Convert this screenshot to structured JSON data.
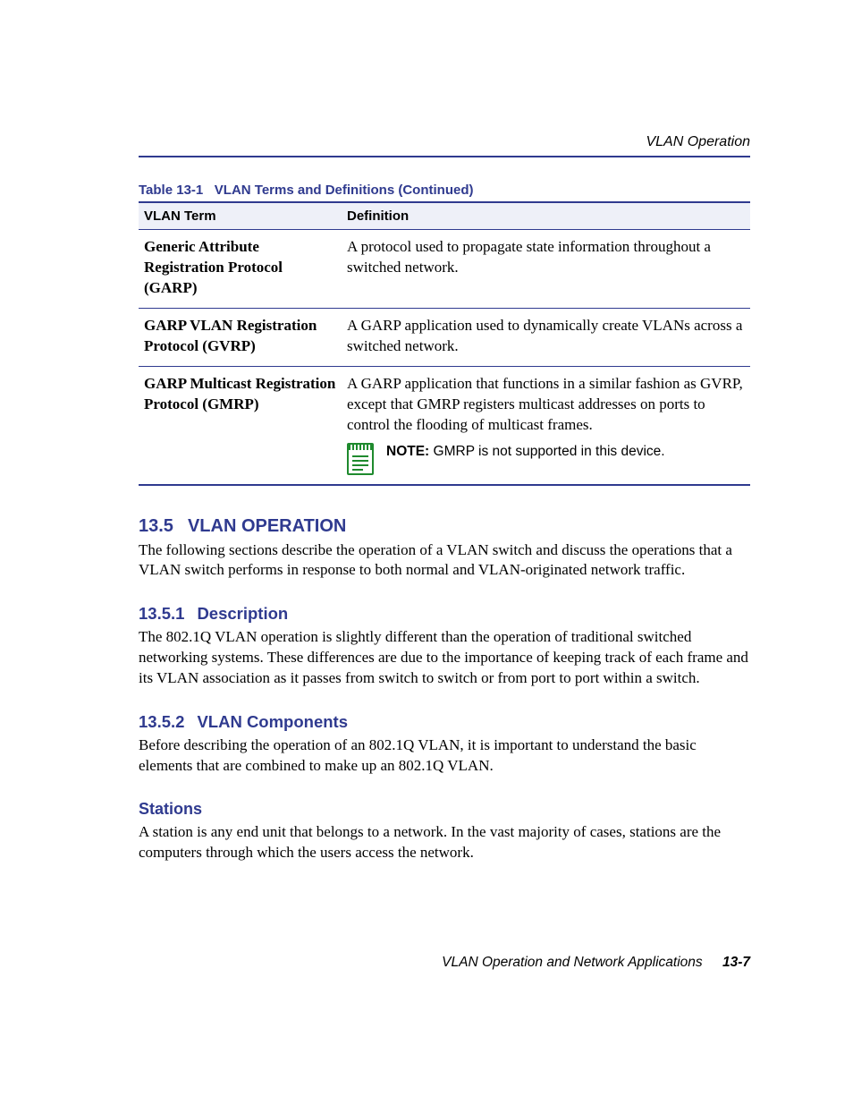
{
  "running_head": "VLAN Operation",
  "table": {
    "caption_prefix": "Table 13-1",
    "caption_title": "VLAN Terms and Definitions (Continued)",
    "headers": {
      "term": "VLAN Term",
      "definition": "Definition"
    },
    "rows": [
      {
        "term": "Generic Attribute Registration Protocol (GARP)",
        "definition": "A protocol used to propagate state information throughout a switched network."
      },
      {
        "term": "GARP VLAN Registration Protocol (GVRP)",
        "definition": "A GARP application used to dynamically create VLANs across a switched network."
      },
      {
        "term": "GARP Multicast Registration Protocol (GMRP)",
        "definition": "A GARP application that functions in a similar fashion as GVRP, except that GMRP registers multicast addresses on ports to control the flooding of multicast frames.",
        "note_label": "NOTE:",
        "note_text": "GMRP is not supported in this device."
      }
    ]
  },
  "sections": {
    "s135": {
      "num": "13.5",
      "title": "VLAN OPERATION",
      "para": "The following sections describe the operation of a VLAN switch and discuss the operations that a VLAN switch performs in response to both normal and VLAN-originated network traffic."
    },
    "s1351": {
      "num": "13.5.1",
      "title": "Description",
      "para": "The 802.1Q VLAN operation is slightly different than the operation of traditional switched networking systems. These differences are due to the importance of keeping track of each frame and its VLAN association as it passes from switch to switch or from port to port within a switch."
    },
    "s1352": {
      "num": "13.5.2",
      "title": "VLAN Components",
      "para": "Before describing the operation of an 802.1Q VLAN, it is important to understand the basic elements that are combined to make up an 802.1Q VLAN."
    },
    "stations": {
      "title": "Stations",
      "para": "A station is any end unit that belongs to a network. In the vast majority of cases, stations are the computers through which the users access the network."
    }
  },
  "footer": {
    "text": "VLAN Operation and Network Applications",
    "page": "13-7"
  }
}
